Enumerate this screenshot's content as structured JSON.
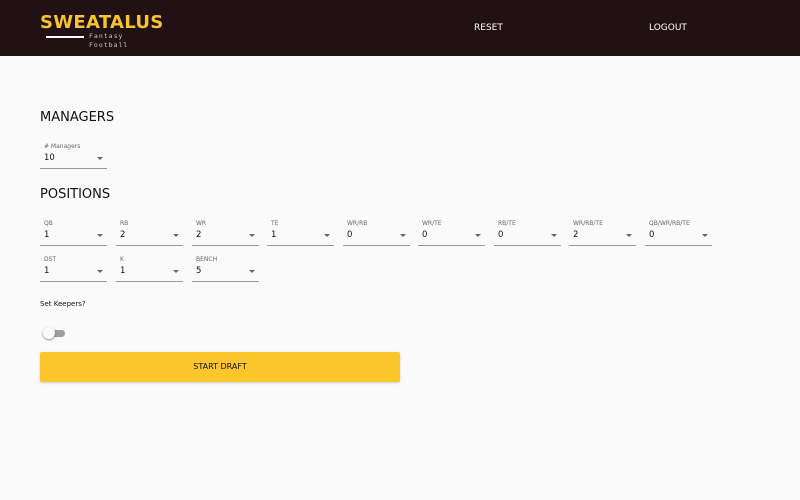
{
  "header": {
    "logo_title": "SWEATALUS",
    "logo_subtitle": "Fantasy Football",
    "nav": {
      "reset": "RESET",
      "logout": "LOGOUT"
    },
    "background_color": "#221114",
    "logo_color": "#f6c431"
  },
  "managers": {
    "title": "MANAGERS",
    "count_label": "# Managers",
    "count_value": "10"
  },
  "positions": {
    "title": "POSITIONS",
    "fields": [
      {
        "label": "QB",
        "value": "1"
      },
      {
        "label": "RB",
        "value": "2"
      },
      {
        "label": "WR",
        "value": "2"
      },
      {
        "label": "TE",
        "value": "1"
      },
      {
        "label": "WR/RB",
        "value": "0"
      },
      {
        "label": "WR/TE",
        "value": "0"
      },
      {
        "label": "RB/TE",
        "value": "0"
      },
      {
        "label": "WR/RB/TE",
        "value": "2"
      },
      {
        "label": "QB/WR/RB/TE",
        "value": "0"
      },
      {
        "label": "DST",
        "value": "1"
      },
      {
        "label": "K",
        "value": "1"
      },
      {
        "label": "BENCH",
        "value": "5"
      }
    ]
  },
  "keepers": {
    "label": "Set Keepers?",
    "enabled": false
  },
  "actions": {
    "start_draft": "START DRAFT",
    "accent_color": "#fbc52c"
  }
}
